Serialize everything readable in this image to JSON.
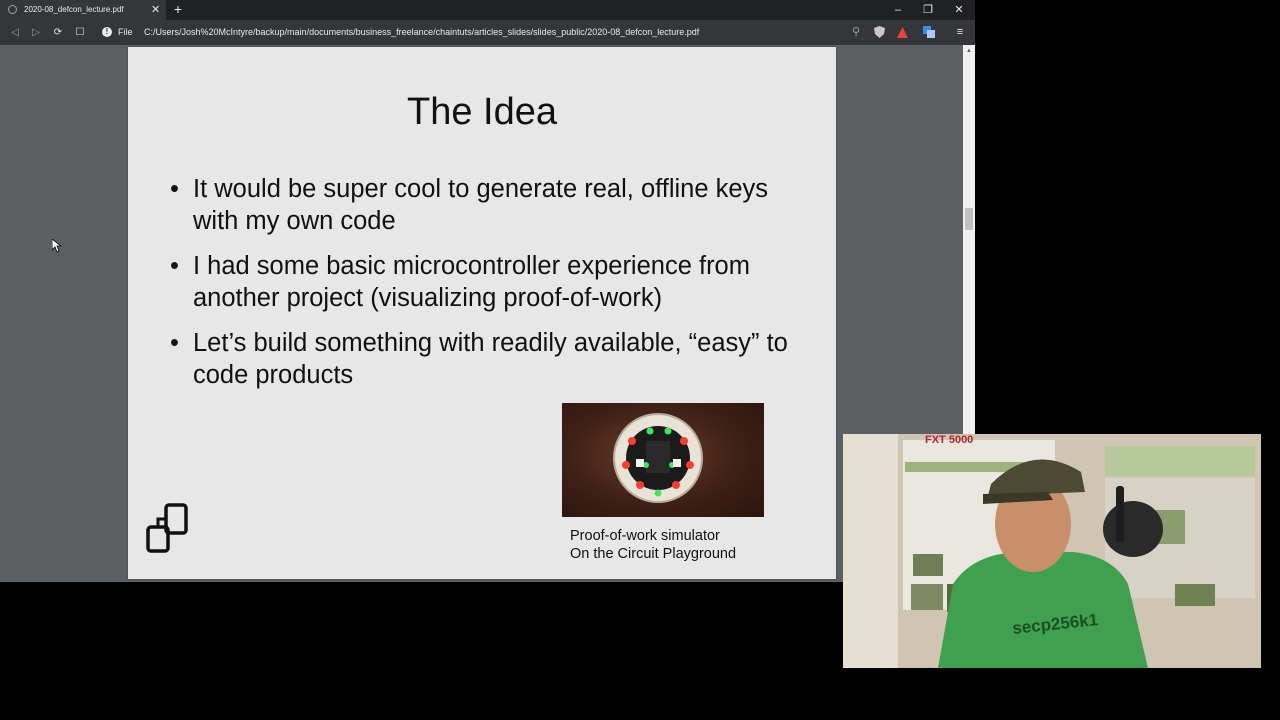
{
  "tab": {
    "title": "2020-08_defcon_lecture.pdf",
    "close": "✕",
    "new": "+"
  },
  "window": {
    "minimize": "–",
    "restore": "❐",
    "close": "✕"
  },
  "toolbar": {
    "back": "◁",
    "forward": "▷",
    "reload": "⟳",
    "bookmark": "☐",
    "info": "!",
    "scheme": "File",
    "url": "C:/Users/Josh%20McIntyre/backup/main/documents/business_freelance/chaintuts/articles_slides/slides_public/2020-08_defcon_lecture.pdf",
    "zoom": "⚲",
    "menu": "≡"
  },
  "slide": {
    "title": "The Idea",
    "bullets": [
      "It would be super cool to generate real, offline keys with my own code",
      "I had some basic microcontroller experience from another project (visualizing proof-of-work)",
      "Let’s build something with readily available, “easy” to code products"
    ],
    "caption_line1": "Proof-of-work simulator",
    "caption_line2": "On the Circuit Playground"
  },
  "webcam": {
    "poster_title": "FXT 5000",
    "shirt_text": "secp256k1"
  },
  "colors": {
    "viewer_bg": "#5c6063",
    "page_bg": "#e7e7e7",
    "chrome_dark": "#202124"
  }
}
